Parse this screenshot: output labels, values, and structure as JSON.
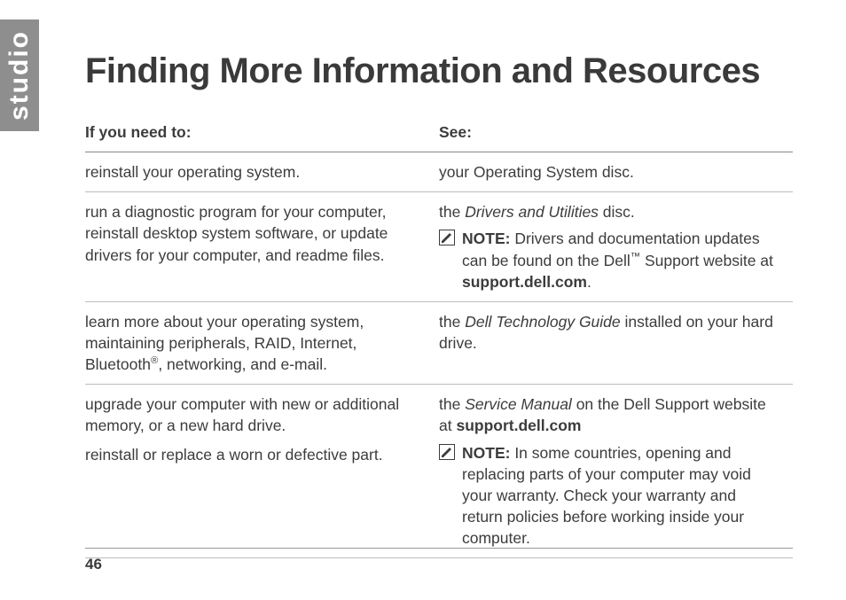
{
  "sidebar": {
    "label": "studio"
  },
  "title": "Finding More Information and Resources",
  "table": {
    "header": {
      "col1": "If you need to:",
      "col2": "See:"
    },
    "rows": [
      {
        "need": "reinstall your operating system.",
        "see": "your Operating System disc."
      },
      {
        "need": "run a diagnostic program for your computer, reinstall desktop system software, or update drivers for your computer, and readme files.",
        "see_pre": "the ",
        "see_ital": "Drivers and Utilities",
        "see_post": " disc.",
        "note_label": "NOTE:",
        "note_body_1": " Drivers and documentation updates can be found on the Dell",
        "note_tm": "™",
        "note_body_2": " Support website at ",
        "note_bold": "support.dell.com",
        "note_body_3": "."
      },
      {
        "need_a": "learn more about your operating system, maintaining peripherals, RAID, Internet, Bluetooth",
        "need_reg": "®",
        "need_b": ", networking, and e-mail.",
        "see_pre": "the ",
        "see_ital": "Dell Technology Guide",
        "see_post": " installed on your hard drive."
      },
      {
        "need_a": "upgrade your computer with new or additional memory, or a new hard drive.",
        "need_b": "reinstall or replace a worn or defective part.",
        "see_pre": "the ",
        "see_ital": "Service Manual",
        "see_post": " on the Dell Support website at ",
        "see_bold": "support.dell.com",
        "note_label": "NOTE:",
        "note_body": " In some countries, opening and replacing parts of your computer may void your warranty. Check your warranty and return policies before working inside your computer."
      }
    ]
  },
  "page_number": "46"
}
